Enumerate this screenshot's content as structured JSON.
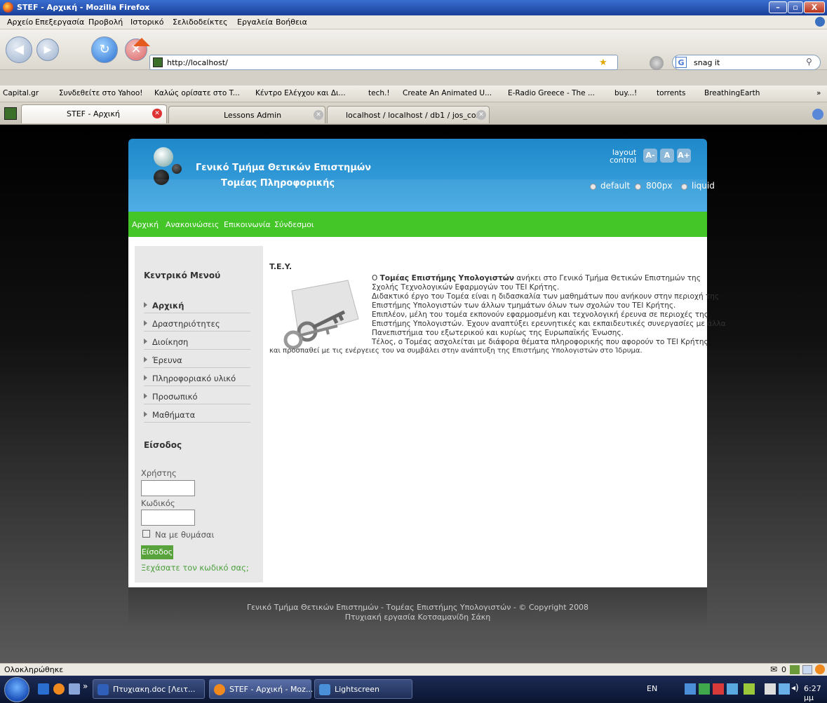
{
  "window": {
    "title": "STEF - Αρχική - Mozilla Firefox"
  },
  "menubar": [
    "Αρχείο",
    "Επεξεργασία",
    "Προβολή",
    "Ιστορικό",
    "Σελιδοδείκτες",
    "Εργαλεία",
    "Βοήθεια"
  ],
  "toolbar": {
    "url": "http://localhost/",
    "search": "snag it"
  },
  "bookmarks": [
    "Capital.gr",
    "Συνδεθείτε στο Yahoo!",
    "Καλώς ορίσατε στο T...",
    "Κέντρο Ελέγχου και Δι...",
    "tech.!",
    "Create An Animated U...",
    "E-Radio Greece - The ...",
    "buy...!",
    "torrents",
    "BreathingEarth"
  ],
  "tabs": [
    {
      "label": "STEF - Αρχική"
    },
    {
      "label": "Lessons Admin"
    },
    {
      "label": "localhost / localhost / db1 / jos_co..."
    }
  ],
  "site": {
    "title1": "Γενικό Τμήμα Θετικών Επιστημών",
    "title2": "Τομέας Πληροφορικής",
    "layout_control": [
      "layout",
      "control"
    ],
    "font_buttons": [
      "A-",
      "A",
      "A+"
    ],
    "width_options": [
      "default",
      "800px",
      "liquid"
    ],
    "nav": [
      "Αρχική",
      "Ανακοινώσεις",
      "Επικοινωνία",
      "Σύνδεσμοι"
    ],
    "menu_title": "Κεντρικό Μενού",
    "menu": [
      "Αρχική",
      "Δραστηριότητες",
      "Διοίκηση",
      "Έρευνα",
      "Πληροφοριακό υλικό",
      "Προσωπικό",
      "Μαθήματα"
    ],
    "login": {
      "title": "Είσοδος",
      "user_label": "Χρήστης",
      "pass_label": "Κωδικός",
      "remember": "Να με θυμάσαι",
      "submit": "Είσοδος",
      "forgot": "Ξεχάσατε τον κωδικό σας;"
    },
    "article": {
      "heading": "T.E.Y.",
      "p1a": "Ο ",
      "p1b": "Τομέας Επιστήμης Υπολογιστών",
      "p1c": " ανήκει στο Γενικό Τμήμα Θετικών Επιστημών της",
      "l2": "Σχολής Τεχνολογικών Εφαρμογών του ΤΕΙ Κρήτης.",
      "l3": "Διδακτικό έργο του Τομέα είναι η διδασκαλία των μαθημάτων που ανήκουν στην περιοχή της",
      "l4": "Επιστήμης Υπολογιστών των άλλων τμημάτων όλων των σχολών του ΤΕΙ Κρήτης.",
      "l5": "Επιπλέον, μέλη του τομέα εκπονούν εφαρμοσμένη και τεχνολογική έρευνα σε περιοχές της",
      "l6": "Επιστήμης Υπολογιστών. Έχουν αναπτύξει ερευνητικές και εκπαιδευτικές συνεργασίες με άλλα",
      "l7": "Πανεπιστήμια του εξωτερικού και κυρίως της Ευρωπαϊκής Ένωσης.",
      "l8": "Τέλος, ο Τομέας ασχολείται με διάφορα θέματα πληροφορικής που αφορούν το ΤΕΙ Κρήτης",
      "l9": "και προσπαθεί με τις ενέργειες του να συμβάλει στην ανάπτυξη της Επιστήμης Υπολογιστών στο Ίδρυμα."
    },
    "footer1": "Γενικό Τμήμα Θετικών Επιστημών - Τομέας Επιστήμης Υπολογιστών - © Copyright 2008",
    "footer2": "Πτυχιακή εργασία Κοτσαμανίδη Σάκη"
  },
  "status": "Ολοκληρώθηκε",
  "taskbar": {
    "items": [
      "Πτυχιακη.doc [Λειτ...",
      "STEF - Αρχική - Moz...",
      "Lightscreen"
    ],
    "lang": "EN",
    "clock": "6:27 μμ",
    "mail_count": "0"
  }
}
